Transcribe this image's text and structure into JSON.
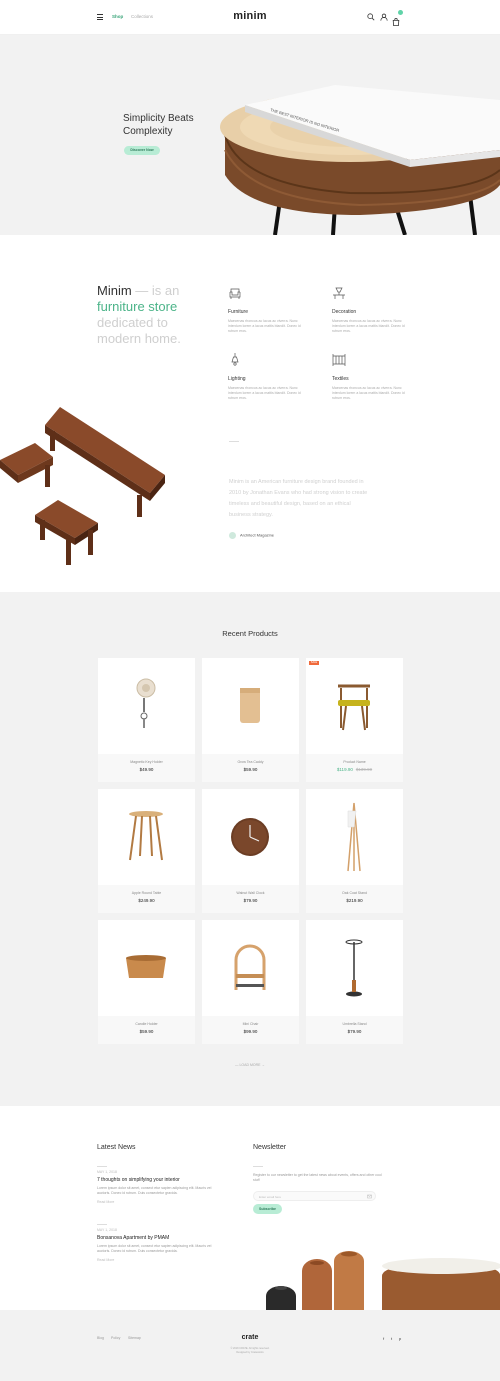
{
  "header": {
    "nav": [
      "Shop",
      "Collections"
    ],
    "logo": "minim"
  },
  "hero": {
    "title_line1": "Simplicity Beats",
    "title_line2": "Complexity",
    "button": "Discover Now",
    "book_spine_text": "THE BEST INTERIOR IS NO INTERIOR"
  },
  "about": {
    "headline": {
      "brand": "Minim",
      "part1": " — is an",
      "highlight": "furniture store",
      "part2": "dedicated to",
      "part3": "modern home."
    },
    "features": [
      {
        "title": "Furniture",
        "text": "Maecenas rhoncus ac lacus ac viverra. Nunc interdum lorem a lacus mattis blandit. Donec id rutrum eros.",
        "icon": "armchair-icon"
      },
      {
        "title": "Decoration",
        "text": "Maecenas rhoncus ac lacus ac viverra. Nunc interdum lorem a lacus mattis blandit. Donec id rutrum eros.",
        "icon": "lamp-decor-icon"
      },
      {
        "title": "Lighting",
        "text": "Maecenas rhoncus ac lacus ac viverra. Nunc interdum lorem a lacus mattis blandit. Donec id rutrum eros.",
        "icon": "pendant-lamp-icon"
      },
      {
        "title": "Textiles",
        "text": "Maecenas rhoncus ac lacus ac viverra. Nunc interdum lorem a lacus mattis blandit. Donec id rutrum eros.",
        "icon": "crib-icon"
      }
    ],
    "quote": "Minim is an American furniture design brand founded in 2010 by Jonathan Evans who had strong vision to create timeless and beautiful design, based on an ethical business strategy.",
    "source": "Architect Magazine"
  },
  "recent": {
    "title": "Recent Products",
    "products": [
      {
        "name": "Magnetic Key Holder",
        "price": "$49.90"
      },
      {
        "name": "Grow Tea Caddy",
        "price": "$59.90"
      },
      {
        "name": "Product Name",
        "price": "$119.90",
        "old_price": "$139.90",
        "badge": "SALE"
      },
      {
        "name": "Apple Round Table",
        "price": "$249.90"
      },
      {
        "name": "Walnut Wall Clock",
        "price": "$79.90"
      },
      {
        "name": "Oak Coat Stand",
        "price": "$219.90"
      },
      {
        "name": "Candle Holder",
        "price": "$59.90"
      },
      {
        "name": "Mini Chair",
        "price": "$99.90"
      },
      {
        "name": "Umbrella Stand",
        "price": "$79.90"
      }
    ],
    "load_more": "—   LOAD MORE   →"
  },
  "news": {
    "title": "Latest News",
    "items": [
      {
        "date": "MAY 1, 2018",
        "title": "7 thoughts on simplifying your interior",
        "text": "Lorem ipsum dolor sit amet, consect etur sapien adipiscing elit. Mauris vel auctoris. Donec id rutrum. Duis consectetur gravida.",
        "more": "Read More"
      },
      {
        "date": "MAY 1, 2018",
        "title": "Bonsanova Apartment by PMAM",
        "text": "Lorem ipsum dolor sit amet, consect etur sapien adipiscing elit. Mauris vel auctoris. Donec id rutrum. Duis consectetur gravida.",
        "more": "Read More"
      }
    ]
  },
  "newsletter": {
    "title": "Newsletter",
    "text": "Register to our newsletter to get the latest news about events, offers and other cool stuff",
    "placeholder": "Enter email here",
    "button": "Subscribe"
  },
  "footer": {
    "links": [
      "Blog",
      "Policy",
      "Sitemap"
    ],
    "logo": "crate",
    "copyright_line1": "© 2018 CRATE. All rights reserved.",
    "copyright_line2": "Designed by Crateworks",
    "social": [
      "f",
      "t",
      "p"
    ]
  },
  "colors": {
    "accent": "#4cb489",
    "button_bg": "#b8ecd5",
    "sale_badge": "#f06a3b",
    "section_gray": "#f2f2f2"
  }
}
